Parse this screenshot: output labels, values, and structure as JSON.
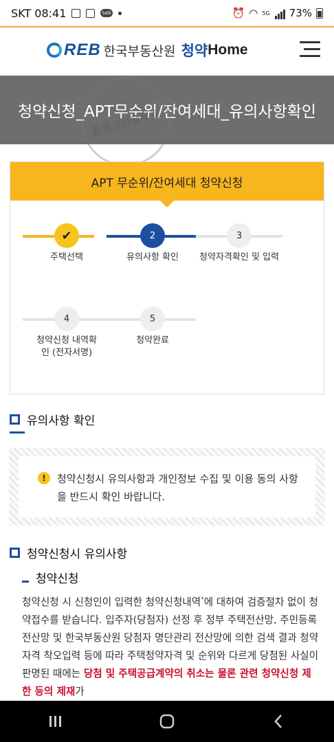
{
  "status_bar": {
    "carrier_time": "SKT 08:41",
    "talk_badge": "talk",
    "battery": "73%",
    "network": "5G"
  },
  "header": {
    "logo_mark": "REB",
    "org_name": "한국부동산원",
    "brand_bold": "청약",
    "brand_rest": "Home"
  },
  "banner": {
    "title": "청약신청_APT무순위/잔여세대_유의사항확인"
  },
  "watermark_text": "블로그한정무료",
  "stepper": {
    "header": "APT 무순위/잔여세대 청약신청",
    "current_step": 2,
    "steps": [
      {
        "number": "",
        "label": "주택선택",
        "status": "done"
      },
      {
        "number": "2",
        "label": "유의사항 확인",
        "status": "active"
      },
      {
        "number": "3",
        "label": "청약자격확인 및 입력",
        "status": "todo"
      },
      {
        "number": "4",
        "label": "청약신청 내역확인 (전자서명)",
        "status": "todo"
      },
      {
        "number": "5",
        "label": "청약완료",
        "status": "todo"
      }
    ]
  },
  "section_notice": {
    "title": "유의사항 확인",
    "notice_text": "청약신청시 유의사항과 개인정보 수집 및 이용 동의 사항을 반드시 확인 바랍니다."
  },
  "section_caution": {
    "title": "청약신청시 유의사항",
    "subtitle": "청약신청",
    "body_normal": "청약신청 시 신청인이 입력한 청약신청내역",
    "body_sup": "*",
    "body_normal2": "에 대하여 검증절차 없이 청약접수를 받습니다. 입주자(당첨자) 선정 후 정부 주택전산망, 주민등록 전산망 및 한국부동산원 당첨자 명단관리 전산망에 의한 검색 결과 청약자격 착오입력 등에 따라 주택청약자격 및 순위와 다르게 당첨된 사실이 판명된 때에는 ",
    "body_red": "당첨 및 주택공급계약의 취소는 물론 관련 청약신청 제한 등의 제재",
    "body_end": "가"
  },
  "colors": {
    "accent_yellow": "#f7b51e",
    "primary_blue": "#1d4fa0",
    "banner_gray": "#6e6e6e",
    "alert_red": "#c8102e"
  }
}
